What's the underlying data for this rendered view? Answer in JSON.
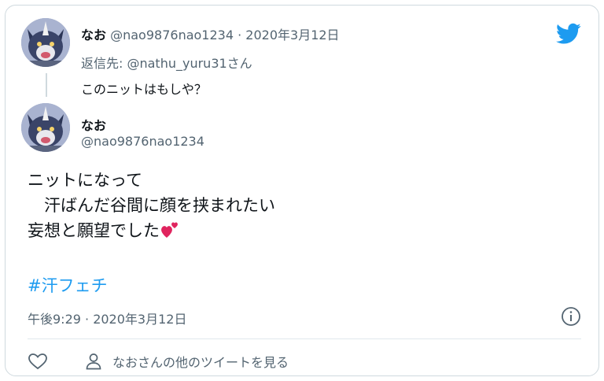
{
  "parent_tweet": {
    "display_name": "なお",
    "handle": "@nao9876nao1234",
    "separator": "·",
    "date": "2020年3月12日",
    "reply_prefix": "返信先: ",
    "reply_to_handle": "@nathu_yuru31",
    "reply_suffix": "さん",
    "text": "このニットはもしや？"
  },
  "quoted_tweet": {
    "display_name": "なお",
    "handle": "@nao9876nao1234",
    "line1": "ニットになって",
    "line2": "　汗ばんだ谷間に顔を挟まれたい",
    "line3": "妄想と願望でした",
    "emoji": "two-hearts-icon",
    "hashtag": "#汗フェチ",
    "timestamp": "午後9:29 · 2020年3月12日"
  },
  "footer": {
    "like_icon": "heart-outline-icon",
    "profile_icon": "person-icon",
    "profile_link": "なおさんの他のツイートを見る"
  },
  "colors": {
    "link": "#1d9bf0",
    "muted": "#536471",
    "border": "#cfd9de",
    "twitter_blue": "#1d9bf0",
    "heart": "#e0245e"
  }
}
